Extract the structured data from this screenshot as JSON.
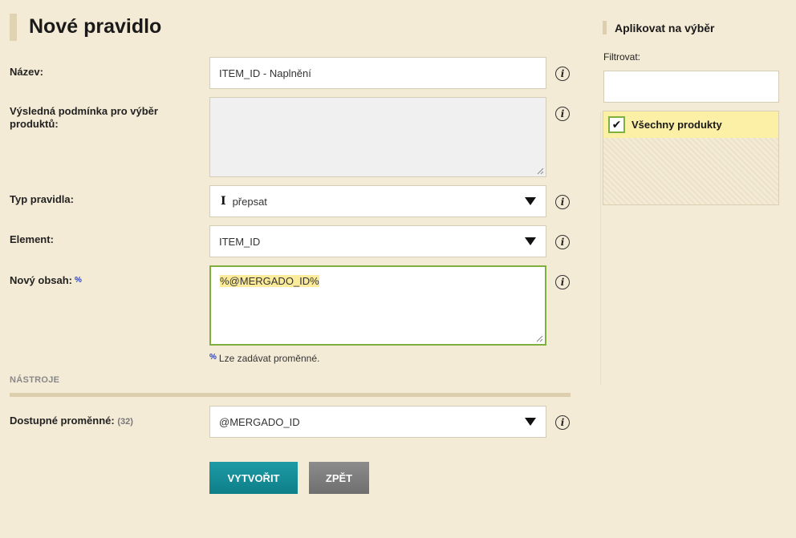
{
  "page": {
    "title": "Nové pravidlo"
  },
  "form": {
    "name": {
      "label": "Název:",
      "value": "ITEM_ID - Naplnění"
    },
    "condition": {
      "label": "Výsledná podmínka pro výběr produktů:",
      "value": ""
    },
    "rule_type": {
      "label": "Typ pravidla:",
      "value": "přepsat"
    },
    "element": {
      "label": "Element:",
      "value": "ITEM_ID"
    },
    "new_content": {
      "label": "Nový obsah:",
      "marker": "%",
      "value": "%@MERGADO_ID%"
    },
    "hint": {
      "marker": "%",
      "text": "Lze zadávat proměnné."
    },
    "tools": {
      "label": "NÁSTROJE"
    },
    "variables": {
      "label": "Dostupné proměnné:",
      "count": "(32)",
      "value": "@MERGADO_ID"
    },
    "info_glyph": "i"
  },
  "buttons": {
    "create": "VYTVOŘIT",
    "back": "ZPĚT"
  },
  "sidebar": {
    "title": "Aplikovat na výběr",
    "filter_label": "Filtrovat:",
    "filter_value": "",
    "items": [
      {
        "label": "Všechny produkty",
        "checked": true
      }
    ]
  },
  "icons": {
    "info": "info-icon",
    "dropdown": "chevron-down-icon",
    "checkbox": "checkmark-icon",
    "cursor": "text-cursor-icon"
  },
  "colors": {
    "background": "#f4ebd6",
    "primary_button": "#0e7f89",
    "secondary_button": "#7a7a7a",
    "active_border": "#7fb03d",
    "highlight": "#fbeb9a",
    "selected_item": "#fbf0a6"
  }
}
